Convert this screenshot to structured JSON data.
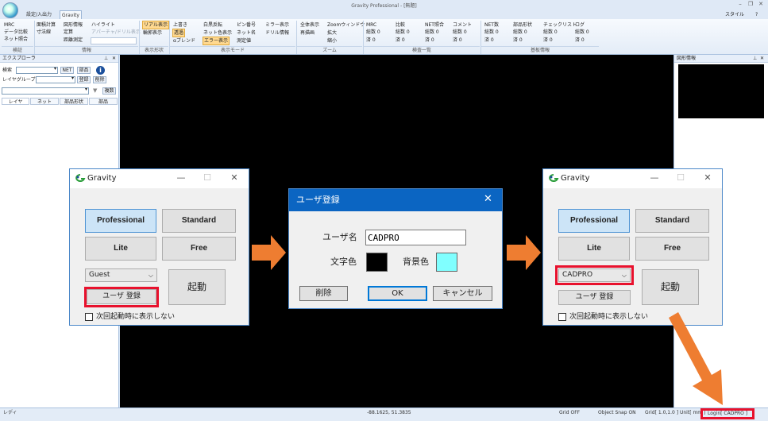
{
  "window": {
    "title": "Gravity Professional - [無題]",
    "style_menu": "スタイル"
  },
  "tabs": [
    "設定/入出力",
    "Gravity"
  ],
  "ribbon": {
    "g1": {
      "items": [
        "MRC",
        "データ比較",
        "ネット照合"
      ],
      "label": "検証"
    },
    "g2": {
      "items": [
        "面積計算",
        "寸法線",
        "図形情報",
        "定算",
        "距離測定"
      ],
      "label": "情報"
    },
    "g2b": {
      "items": [
        "ハイライト",
        "アパーチャ/ドリル表示"
      ]
    },
    "g3": {
      "items": [
        "リアル表示",
        "輪郭表示"
      ],
      "label": "表示形状"
    },
    "g4": {
      "items": [
        "上書き",
        "透過",
        "αブレンド",
        "白黒反転",
        "ネット色表示",
        "エラー表示",
        "ピン番号",
        "ネット名",
        "測定値",
        "ミラー表示",
        "ドリル情報"
      ],
      "label": "表示モード"
    },
    "g5": {
      "items": [
        "全体表示",
        "再描画",
        "Zoomウィンドウ",
        "拡大",
        "縮小"
      ],
      "label": "ズーム"
    },
    "g6": {
      "label": "検査一覧",
      "cols": [
        {
          "title": "MRC",
          "rows": [
            "総数 0",
            "済 0"
          ]
        },
        {
          "title": "比較",
          "rows": [
            "総数 0",
            "済 0"
          ]
        },
        {
          "title": "NET照合",
          "rows": [
            "総数 0",
            "済 0"
          ]
        },
        {
          "title": "コメント",
          "rows": [
            "総数 0",
            "済 0"
          ]
        }
      ]
    },
    "g7": {
      "label": "基板情報",
      "cols": [
        {
          "title": "NET数",
          "rows": [
            "総数 0",
            "済 0"
          ]
        },
        {
          "title": "部品形状",
          "rows": [
            "総数 0",
            "済 0"
          ]
        },
        {
          "title": "チェックリスト",
          "rows": [
            "総数 0",
            "済 0"
          ]
        },
        {
          "title": "ログ",
          "rows": [
            "総数 0",
            "済 0"
          ]
        }
      ]
    }
  },
  "left_panel": {
    "title": "エクスプローラ",
    "search_label": "検索",
    "layer_group_label": "レイヤグループ",
    "btn_net": "NET",
    "btn_part": "部品",
    "btn_register": "登録",
    "btn_delete": "削除",
    "btn_copy": "複数",
    "tabs": [
      "レイヤ",
      "ネット",
      "部品形状",
      "部品"
    ]
  },
  "right_panel": {
    "title": "図形情報"
  },
  "gravity_dialog": {
    "title": "Gravity",
    "editions": [
      "Professional",
      "Standard",
      "Lite",
      "Free"
    ],
    "launch": "起動",
    "user_register": "ユーザ 登録",
    "no_show": "次回起動時に表示しない",
    "user_before": "Guest",
    "user_after": "CADPRO"
  },
  "user_dialog": {
    "title": "ユーザ登録",
    "name_label": "ユーザ名",
    "name_value": "CADPRO",
    "text_color_label": "文字色",
    "bg_color_label": "背景色",
    "btn_delete": "削除",
    "btn_ok": "OK",
    "btn_cancel": "キャンセル",
    "text_color": "#000000",
    "bg_color": "#80ffff"
  },
  "statusbar": {
    "ready": "レディ",
    "coords": "-88.1625, 51.3835",
    "grid": "Grid OFF",
    "snap": "Object Snap ON",
    "grid_unit": "Grid[ 1.0,1.0 ]  Unit[ mm ]",
    "login": "Login[ CADPRO ]"
  },
  "colors": {
    "accent": "#0b65c2",
    "highlight": "#e8112d",
    "arrow": "#ee7d31",
    "canvas": "#000000"
  }
}
